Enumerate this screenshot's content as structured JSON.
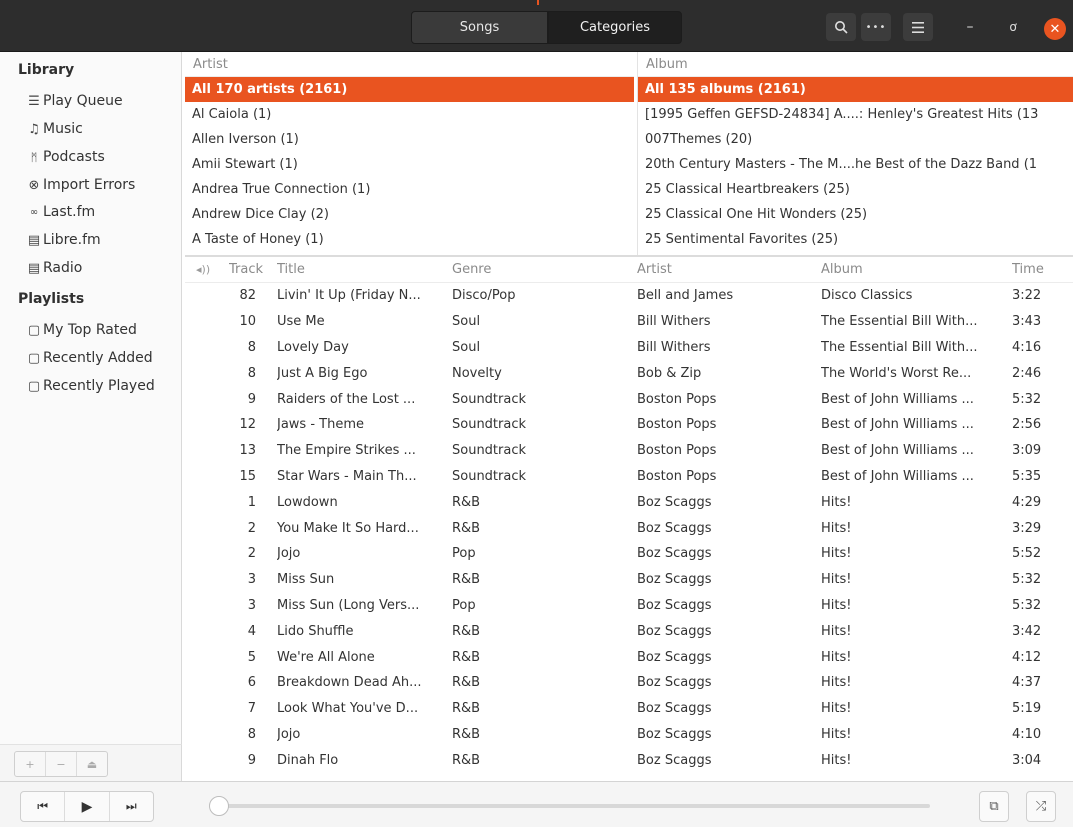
{
  "header": {
    "tabs": [
      {
        "label": "Songs"
      },
      {
        "label": "Categories"
      }
    ],
    "active_tab": "Categories",
    "icons": [
      "search-icon",
      "more-icon",
      "menu-icon",
      "minimize-icon",
      "restore-icon",
      "close-icon"
    ]
  },
  "sidebar": {
    "library_heading": "Library",
    "library_items": [
      {
        "label": "Play Queue",
        "icon": "play-queue-icon"
      },
      {
        "label": "Music",
        "icon": "music-note-icon"
      },
      {
        "label": "Podcasts",
        "icon": "podcast-icon"
      },
      {
        "label": "Import Errors",
        "icon": "import-errors-icon"
      },
      {
        "label": "Last.fm",
        "icon": "lastfm-icon"
      },
      {
        "label": "Libre.fm",
        "icon": "librefm-icon"
      },
      {
        "label": "Radio",
        "icon": "radio-icon"
      }
    ],
    "playlists_heading": "Playlists",
    "playlist_items": [
      {
        "label": "My Top Rated",
        "icon": "playlist-icon"
      },
      {
        "label": "Recently Added",
        "icon": "playlist-icon"
      },
      {
        "label": "Recently Played",
        "icon": "playlist-icon"
      }
    ]
  },
  "browser": {
    "artist_header": "Artist",
    "artists": [
      "All 170 artists (2161)",
      "Al Caiola (1)",
      "Allen Iverson (1)",
      "Amii Stewart (1)",
      "Andrea True Connection (1)",
      "Andrew Dice Clay (2)",
      "A Taste of Honey (1)"
    ],
    "album_header": "Album",
    "albums": [
      "All 135 albums (2161)",
      "[1995 Geffen GEFSD-24834] A....: Henley's Greatest Hits (13",
      "007Themes (20)",
      "20th Century Masters - The M....he Best of the Dazz Band (1",
      "25 Classical Heartbreakers (25)",
      "25 Classical One Hit Wonders (25)",
      "25 Sentimental Favorites (25)"
    ]
  },
  "tracklist": {
    "columns": [
      "Track",
      "Title",
      "Genre",
      "Artist",
      "Album",
      "Time"
    ],
    "rows": [
      [
        "82",
        "Livin' It Up (Friday N...",
        "Disco/Pop",
        "Bell and James",
        "Disco Classics",
        "3:22"
      ],
      [
        "10",
        "Use Me",
        "Soul",
        "Bill Withers",
        "The Essential Bill With...",
        "3:43"
      ],
      [
        "8",
        "Lovely Day",
        "Soul",
        "Bill Withers",
        "The Essential Bill With...",
        "4:16"
      ],
      [
        "8",
        "Just A Big Ego",
        "Novelty",
        "Bob & Zip",
        "The World's Worst Re...",
        "2:46"
      ],
      [
        "9",
        "Raiders of the Lost ...",
        "Soundtrack",
        "Boston Pops",
        "Best of John Williams ...",
        "5:32"
      ],
      [
        "12",
        "Jaws - Theme",
        "Soundtrack",
        "Boston Pops",
        "Best of John Williams ...",
        "2:56"
      ],
      [
        "13",
        "The Empire Strikes ...",
        "Soundtrack",
        "Boston Pops",
        "Best of John Williams ...",
        "3:09"
      ],
      [
        "15",
        "Star Wars - Main Th...",
        "Soundtrack",
        "Boston Pops",
        "Best of John Williams ...",
        "5:35"
      ],
      [
        "1",
        "Lowdown",
        "R&B",
        "Boz Scaggs",
        "Hits!",
        "4:29"
      ],
      [
        "2",
        "You Make It So Hard...",
        "R&B",
        "Boz Scaggs",
        "Hits!",
        "3:29"
      ],
      [
        "2",
        "Jojo",
        "Pop",
        "Boz Scaggs",
        "Hits!",
        "5:52"
      ],
      [
        "3",
        "Miss Sun",
        "R&B",
        "Boz Scaggs",
        "Hits!",
        "5:32"
      ],
      [
        "3",
        "Miss Sun (Long Vers...",
        "Pop",
        "Boz Scaggs",
        "Hits!",
        "5:32"
      ],
      [
        "4",
        "Lido Shuffle",
        "R&B",
        "Boz Scaggs",
        "Hits!",
        "3:42"
      ],
      [
        "5",
        "We're All Alone",
        "R&B",
        "Boz Scaggs",
        "Hits!",
        "4:12"
      ],
      [
        "6",
        "Breakdown Dead Ah...",
        "R&B",
        "Boz Scaggs",
        "Hits!",
        "4:37"
      ],
      [
        "7",
        "Look What You've D...",
        "R&B",
        "Boz Scaggs",
        "Hits!",
        "5:19"
      ],
      [
        "8",
        "Jojo",
        "R&B",
        "Boz Scaggs",
        "Hits!",
        "4:10"
      ],
      [
        "9",
        "Dinah Flo",
        "R&B",
        "Boz Scaggs",
        "Hits!",
        "3:04"
      ]
    ]
  },
  "player": {
    "position_fraction": 0,
    "icons": [
      "previous-icon",
      "play-icon",
      "next-icon",
      "repeat-icon",
      "shuffle-icon"
    ]
  },
  "colors": {
    "accent": "#e95420",
    "header_bg": "#2d2d2d"
  }
}
